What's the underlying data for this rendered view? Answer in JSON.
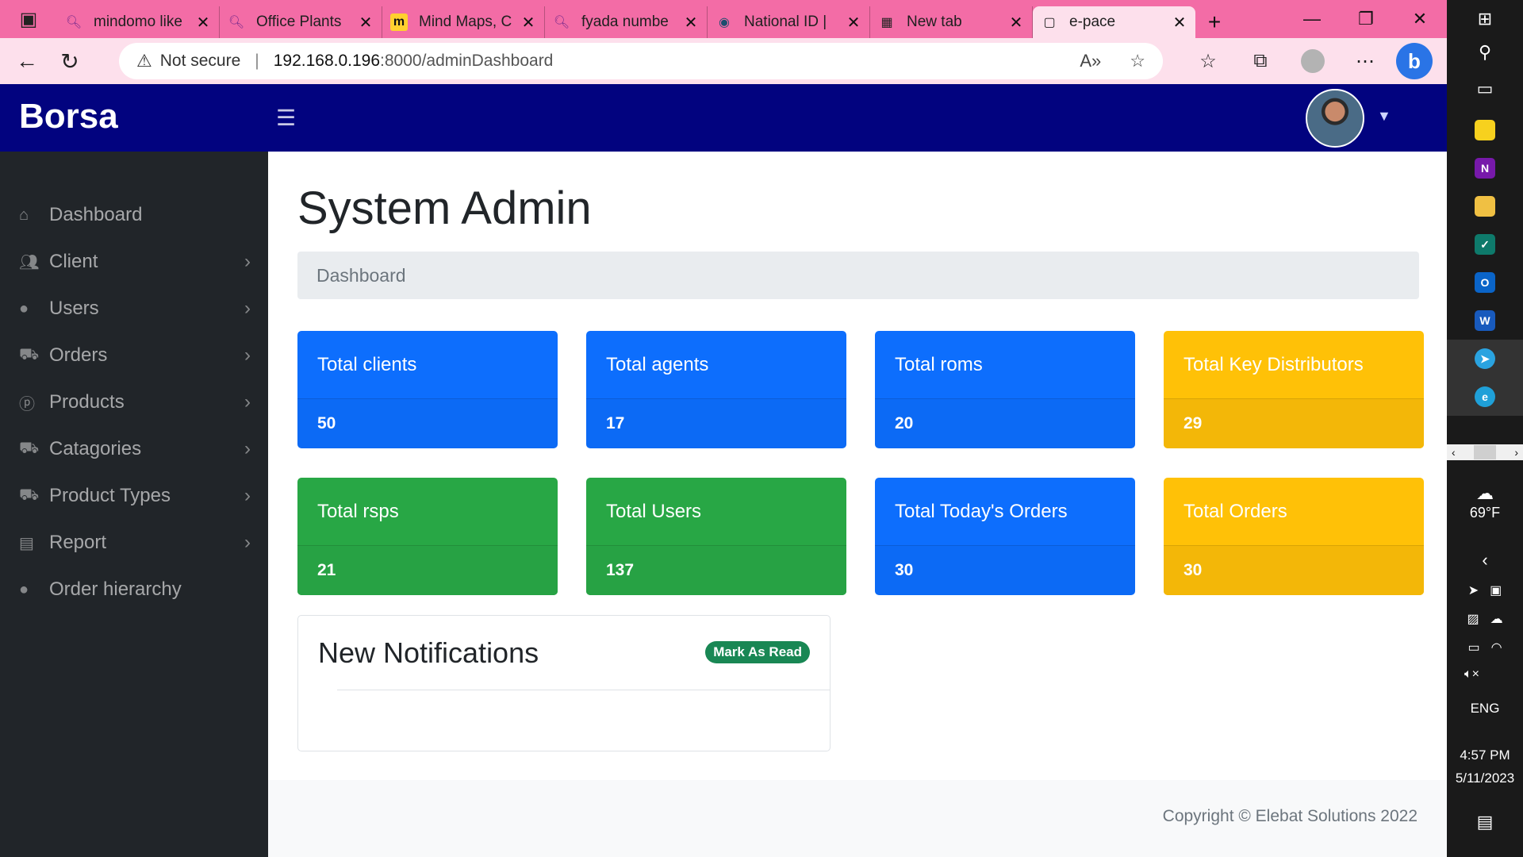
{
  "browser": {
    "tabs": [
      {
        "title": "mindomo like",
        "icon": "search-icon"
      },
      {
        "title": "Office Plants",
        "icon": "search-icon"
      },
      {
        "title": "Mind Maps, C",
        "icon": "miro-icon"
      },
      {
        "title": "fyada numbe",
        "icon": "search-icon"
      },
      {
        "title": "National ID |",
        "icon": "globe-icon"
      },
      {
        "title": "New tab",
        "icon": "new-tab-icon"
      },
      {
        "title": "e-pace",
        "icon": "page-icon"
      }
    ],
    "security_label": "Not secure",
    "url_host": "192.168.0.196",
    "url_path": ":8000/adminDashboard"
  },
  "app": {
    "brand": "Borsa",
    "page_title": "System Admin",
    "breadcrumb": "Dashboard"
  },
  "sidebar": {
    "items": [
      {
        "label": "Dashboard",
        "icon": "home-icon",
        "has_children": false
      },
      {
        "label": "Client",
        "icon": "users-group-icon",
        "has_children": true
      },
      {
        "label": "Users",
        "icon": "user-icon",
        "has_children": true
      },
      {
        "label": "Orders",
        "icon": "cart-icon",
        "has_children": true
      },
      {
        "label": "Products",
        "icon": "product-icon",
        "has_children": true
      },
      {
        "label": "Catagories",
        "icon": "cart-icon",
        "has_children": true
      },
      {
        "label": "Product Types",
        "icon": "cart-icon",
        "has_children": true
      },
      {
        "label": "Report",
        "icon": "chart-icon",
        "has_children": true
      },
      {
        "label": "Order hierarchy",
        "icon": "user-icon",
        "has_children": false
      }
    ]
  },
  "cards": [
    {
      "title": "Total clients",
      "value": "50",
      "color": "#0d6efd"
    },
    {
      "title": "Total agents",
      "value": "17",
      "color": "#0d6efd"
    },
    {
      "title": "Total roms",
      "value": "20",
      "color": "#0d6efd"
    },
    {
      "title": "Total Key Distributors",
      "value": "29",
      "color": "#ffc107"
    },
    {
      "title": "Total rsps",
      "value": "21",
      "color": "#28a745"
    },
    {
      "title": "Total Users",
      "value": "137",
      "color": "#28a745"
    },
    {
      "title": "Total Today's Orders",
      "value": "30",
      "color": "#0d6efd"
    },
    {
      "title": "Total Orders",
      "value": "30",
      "color": "#ffc107"
    }
  ],
  "notifications": {
    "title": "New Notifications",
    "mark_read_label": "Mark As Read"
  },
  "footer": {
    "copyright": "Copyright © Elebat Solutions 2022"
  },
  "taskbar": {
    "weather": "69°F",
    "language": "ENG",
    "time": "4:57 PM",
    "date": "5/11/2023"
  },
  "colors": {
    "tabbar": "#f36ca6",
    "navbar": "#02037f",
    "sidebar": "#212529"
  }
}
